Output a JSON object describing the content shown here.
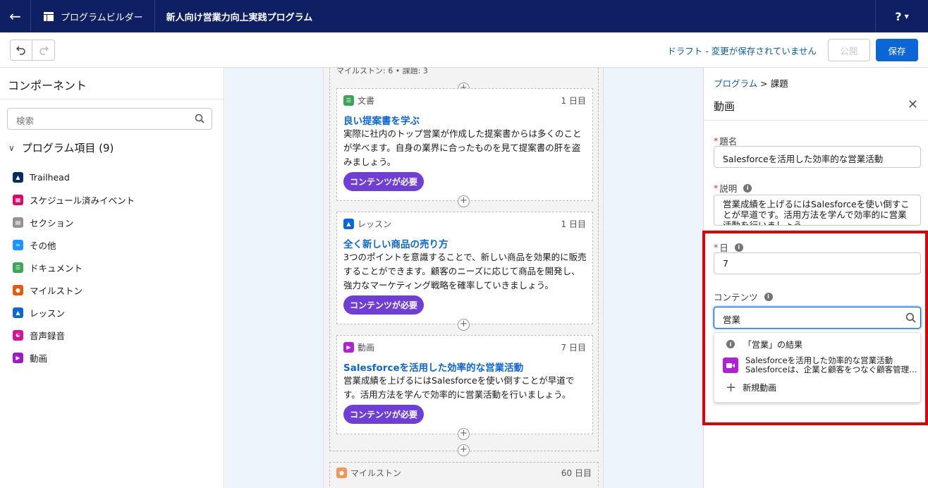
{
  "header": {
    "back_icon": "arrow-left-icon",
    "app_name": "プログラムビルダー",
    "program_title": "新人向け営業力向上実践プログラム",
    "help_label": "?"
  },
  "toolbar": {
    "draft_status": "ドラフト - 変更が保存されていません",
    "publish_label": "公開",
    "save_label": "保存"
  },
  "left_panel": {
    "title": "コンポーネント",
    "search_placeholder": "検索",
    "group_label": "プログラム項目 (9)",
    "items": [
      {
        "label": "Trailhead",
        "color": "#032d60"
      },
      {
        "label": "スケジュール済みイベント",
        "color": "#e3066a"
      },
      {
        "label": "セクション",
        "color": "#939393"
      },
      {
        "label": "その他",
        "color": "#1b96ff"
      },
      {
        "label": "ドキュメント",
        "color": "#3ba755"
      },
      {
        "label": "マイルストン",
        "color": "#e8590c"
      },
      {
        "label": "レッスン",
        "color": "#0b66d6"
      },
      {
        "label": "音声録音",
        "color": "#d6129b"
      },
      {
        "label": "動画",
        "color": "#9e19c9"
      }
    ]
  },
  "canvas": {
    "milestone_header": "マイルストン: 6 • 課題: 3",
    "cards": [
      {
        "type": "文書",
        "day": "1 日目",
        "title": "良い提案書を学ぶ",
        "description": "実際に社内のトップ営業が作成した提案書からは多くのことが学べます。自身の業界に合ったものを見て提案書の肝を盗みましょう。",
        "badge": "コンテンツが必要",
        "color": "#3ba755"
      },
      {
        "type": "レッスン",
        "day": "1 日目",
        "title": "全く新しい商品の売り方",
        "description": "3つのポイントを意識することで、新しい商品を効果的に販売することができます。顧客のニーズに応じて商品を開発し、強力なマーケティング戦略を確率していきましょう。",
        "badge": "コンテンツが必要",
        "color": "#0b66d6"
      },
      {
        "type": "動画",
        "day": "7 日目",
        "title": "Salesforceを活用した効率的な営業活動",
        "description": "営業成績を上げるにはSalesforceを使い倒すことが早道です。活用方法を学んで効率的に営業活動を行いましょう。",
        "badge": "コンテンツが必要",
        "color": "#b21fd6"
      }
    ],
    "next_milestone": {
      "type": "マイルストン",
      "day": "60 日目",
      "color": "#f49756"
    }
  },
  "right_panel": {
    "breadcrumb_link": "プログラム",
    "breadcrumb_sep": ">",
    "breadcrumb_current": "課題",
    "title": "動画",
    "title_label": "題名",
    "title_value": "Salesforceを活用した効率的な営業活動",
    "desc_label": "説明",
    "desc_value": "営業成績を上げるにはSalesforceを使い倒すことが早道です。活用方法を学んで効率的に営業活動を行いましょう。",
    "day_label": "日",
    "day_value": "7",
    "content_label": "コンテンツ",
    "content_value": "営業",
    "dropdown": {
      "results_label": "「営業」の結果",
      "result_title": "Salesforceを活用した効率的な営業活動",
      "result_subtitle": "Salesforceは、企業と顧客をつなぐ顧客管理プラットフォームです",
      "new_label": "新規動画"
    }
  },
  "accent_colors": {
    "header": "#0e1f63",
    "primary": "#0b66d6",
    "badge": "#6f3ed6",
    "highlight": "#e40000"
  }
}
